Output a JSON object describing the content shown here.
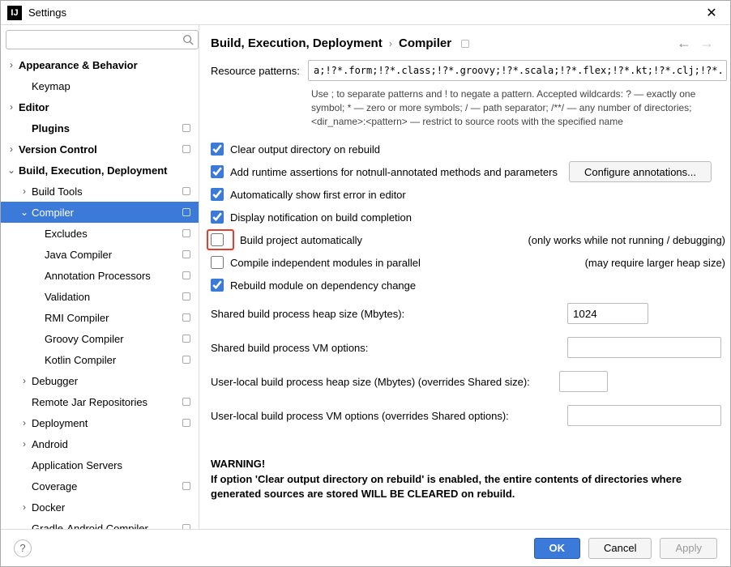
{
  "window": {
    "title": "Settings"
  },
  "breadcrumb": {
    "parent": "Build, Execution, Deployment",
    "current": "Compiler"
  },
  "sidebar": {
    "items": [
      {
        "label": "Appearance & Behavior",
        "arrow": "right",
        "bold": true,
        "indent": 0
      },
      {
        "label": "Keymap",
        "arrow": "",
        "bold": false,
        "indent": 1
      },
      {
        "label": "Editor",
        "arrow": "right",
        "bold": true,
        "indent": 0
      },
      {
        "label": "Plugins",
        "arrow": "",
        "bold": true,
        "indent": 1,
        "square": true
      },
      {
        "label": "Version Control",
        "arrow": "right",
        "bold": true,
        "indent": 0,
        "square": true
      },
      {
        "label": "Build, Execution, Deployment",
        "arrow": "down",
        "bold": true,
        "indent": 0
      },
      {
        "label": "Build Tools",
        "arrow": "right",
        "bold": false,
        "indent": 1,
        "square": true
      },
      {
        "label": "Compiler",
        "arrow": "down",
        "bold": false,
        "indent": 1,
        "square": true,
        "selected": true
      },
      {
        "label": "Excludes",
        "arrow": "",
        "bold": false,
        "indent": 2,
        "square": true
      },
      {
        "label": "Java Compiler",
        "arrow": "",
        "bold": false,
        "indent": 2,
        "square": true
      },
      {
        "label": "Annotation Processors",
        "arrow": "",
        "bold": false,
        "indent": 2,
        "square": true
      },
      {
        "label": "Validation",
        "arrow": "",
        "bold": false,
        "indent": 2,
        "square": true
      },
      {
        "label": "RMI Compiler",
        "arrow": "",
        "bold": false,
        "indent": 2,
        "square": true
      },
      {
        "label": "Groovy Compiler",
        "arrow": "",
        "bold": false,
        "indent": 2,
        "square": true
      },
      {
        "label": "Kotlin Compiler",
        "arrow": "",
        "bold": false,
        "indent": 2,
        "square": true
      },
      {
        "label": "Debugger",
        "arrow": "right",
        "bold": false,
        "indent": 1
      },
      {
        "label": "Remote Jar Repositories",
        "arrow": "",
        "bold": false,
        "indent": 1,
        "square": true
      },
      {
        "label": "Deployment",
        "arrow": "right",
        "bold": false,
        "indent": 1,
        "square": true
      },
      {
        "label": "Android",
        "arrow": "right",
        "bold": false,
        "indent": 1
      },
      {
        "label": "Application Servers",
        "arrow": "",
        "bold": false,
        "indent": 1
      },
      {
        "label": "Coverage",
        "arrow": "",
        "bold": false,
        "indent": 1,
        "square": true
      },
      {
        "label": "Docker",
        "arrow": "right",
        "bold": false,
        "indent": 1
      },
      {
        "label": "Gradle-Android Compiler",
        "arrow": "",
        "bold": false,
        "indent": 1,
        "square": true
      }
    ]
  },
  "compiler": {
    "resource_patterns_label": "Resource patterns:",
    "resource_patterns_value": "a;!?*.form;!?*.class;!?*.groovy;!?*.scala;!?*.flex;!?*.kt;!?*.clj;!?*.aj",
    "resource_help": "Use ; to separate patterns and ! to negate a pattern. Accepted wildcards: ? — exactly one symbol; * — zero or more symbols; / — path separator; /**/ — any number of directories; <dir_name>:<pattern> — restrict to source roots with the specified name",
    "checks": {
      "clear_output": {
        "label": "Clear output directory on rebuild",
        "checked": true
      },
      "add_runtime": {
        "label": "Add runtime assertions for notnull-annotated methods and parameters",
        "checked": true,
        "btn": "Configure annotations..."
      },
      "auto_error": {
        "label": "Automatically show first error in editor",
        "checked": true
      },
      "notify_build": {
        "label": "Display notification on build completion",
        "checked": true
      },
      "build_auto": {
        "label": "Build project automatically",
        "checked": false,
        "hint": "(only works while not running / debugging)"
      },
      "parallel": {
        "label": "Compile independent modules in parallel",
        "checked": false,
        "hint": "(may require larger heap size)"
      },
      "rebuild_dep": {
        "label": "Rebuild module on dependency change",
        "checked": true
      }
    },
    "fields": {
      "heap_size": {
        "label": "Shared build process heap size (Mbytes):",
        "value": "1024"
      },
      "vm_options": {
        "label": "Shared build process VM options:",
        "value": ""
      },
      "user_heap": {
        "label": "User-local build process heap size (Mbytes) (overrides Shared size):",
        "value": ""
      },
      "user_vm": {
        "label": "User-local build process VM options (overrides Shared options):",
        "value": ""
      }
    },
    "warning_title": "WARNING!",
    "warning_body": "If option 'Clear output directory on rebuild' is enabled, the entire contents of directories where generated sources are stored WILL BE CLEARED on rebuild."
  },
  "footer": {
    "ok": "OK",
    "cancel": "Cancel",
    "apply": "Apply"
  }
}
